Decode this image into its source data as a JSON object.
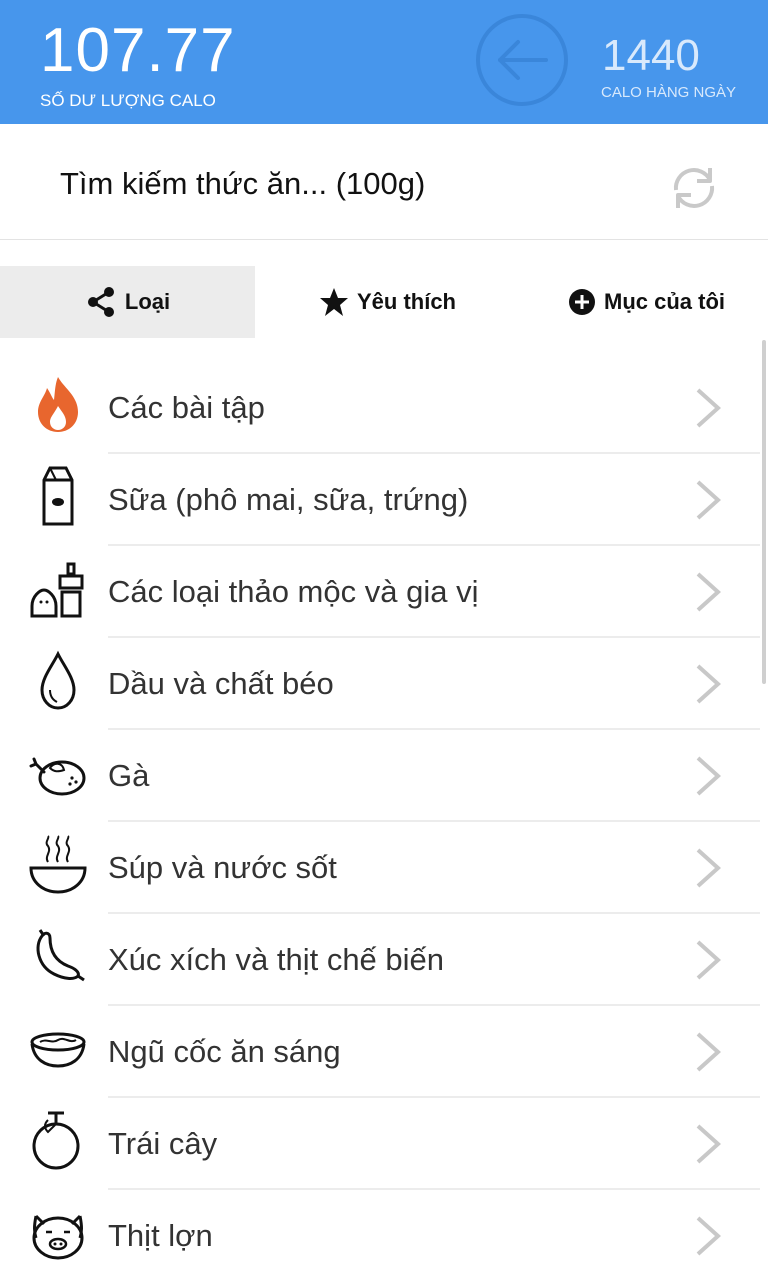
{
  "colors": {
    "accent": "#4796ec",
    "fire": "#e8662e",
    "chevron": "#c8c8c8"
  },
  "header": {
    "balance_value": "107.77",
    "balance_label": "SỐ DƯ LƯỢNG CALO",
    "back_icon": "arrow-left-circle-icon",
    "daily_value": "1440",
    "daily_label": "CALO HÀNG NGÀY"
  },
  "search": {
    "text": "Tìm kiếm thức ăn... (100g)",
    "refresh_icon": "refresh-icon"
  },
  "tabs": [
    {
      "label": "Loại",
      "icon": "share-icon",
      "active": true
    },
    {
      "label": "Yêu thích",
      "icon": "star-icon",
      "active": false
    },
    {
      "label": "Mục của tôi",
      "icon": "plus-circle-icon",
      "active": false
    }
  ],
  "categories": [
    {
      "label": "Các bài tập",
      "icon": "fire-icon"
    },
    {
      "label": "Sữa (phô mai, sữa, trứng)",
      "icon": "milk-carton-icon"
    },
    {
      "label": "Các loại thảo mộc và gia vị",
      "icon": "salt-pepper-icon"
    },
    {
      "label": "Dầu và chất béo",
      "icon": "oil-drop-icon"
    },
    {
      "label": "Gà",
      "icon": "roast-chicken-icon"
    },
    {
      "label": "Súp và nước sốt",
      "icon": "soup-bowl-icon"
    },
    {
      "label": "Xúc xích và thịt chế biến",
      "icon": "sausage-icon"
    },
    {
      "label": "Ngũ cốc ăn sáng",
      "icon": "cereal-bowl-icon"
    },
    {
      "label": "Trái cây",
      "icon": "fruit-icon"
    },
    {
      "label": "Thịt lợn",
      "icon": "pig-icon"
    }
  ]
}
